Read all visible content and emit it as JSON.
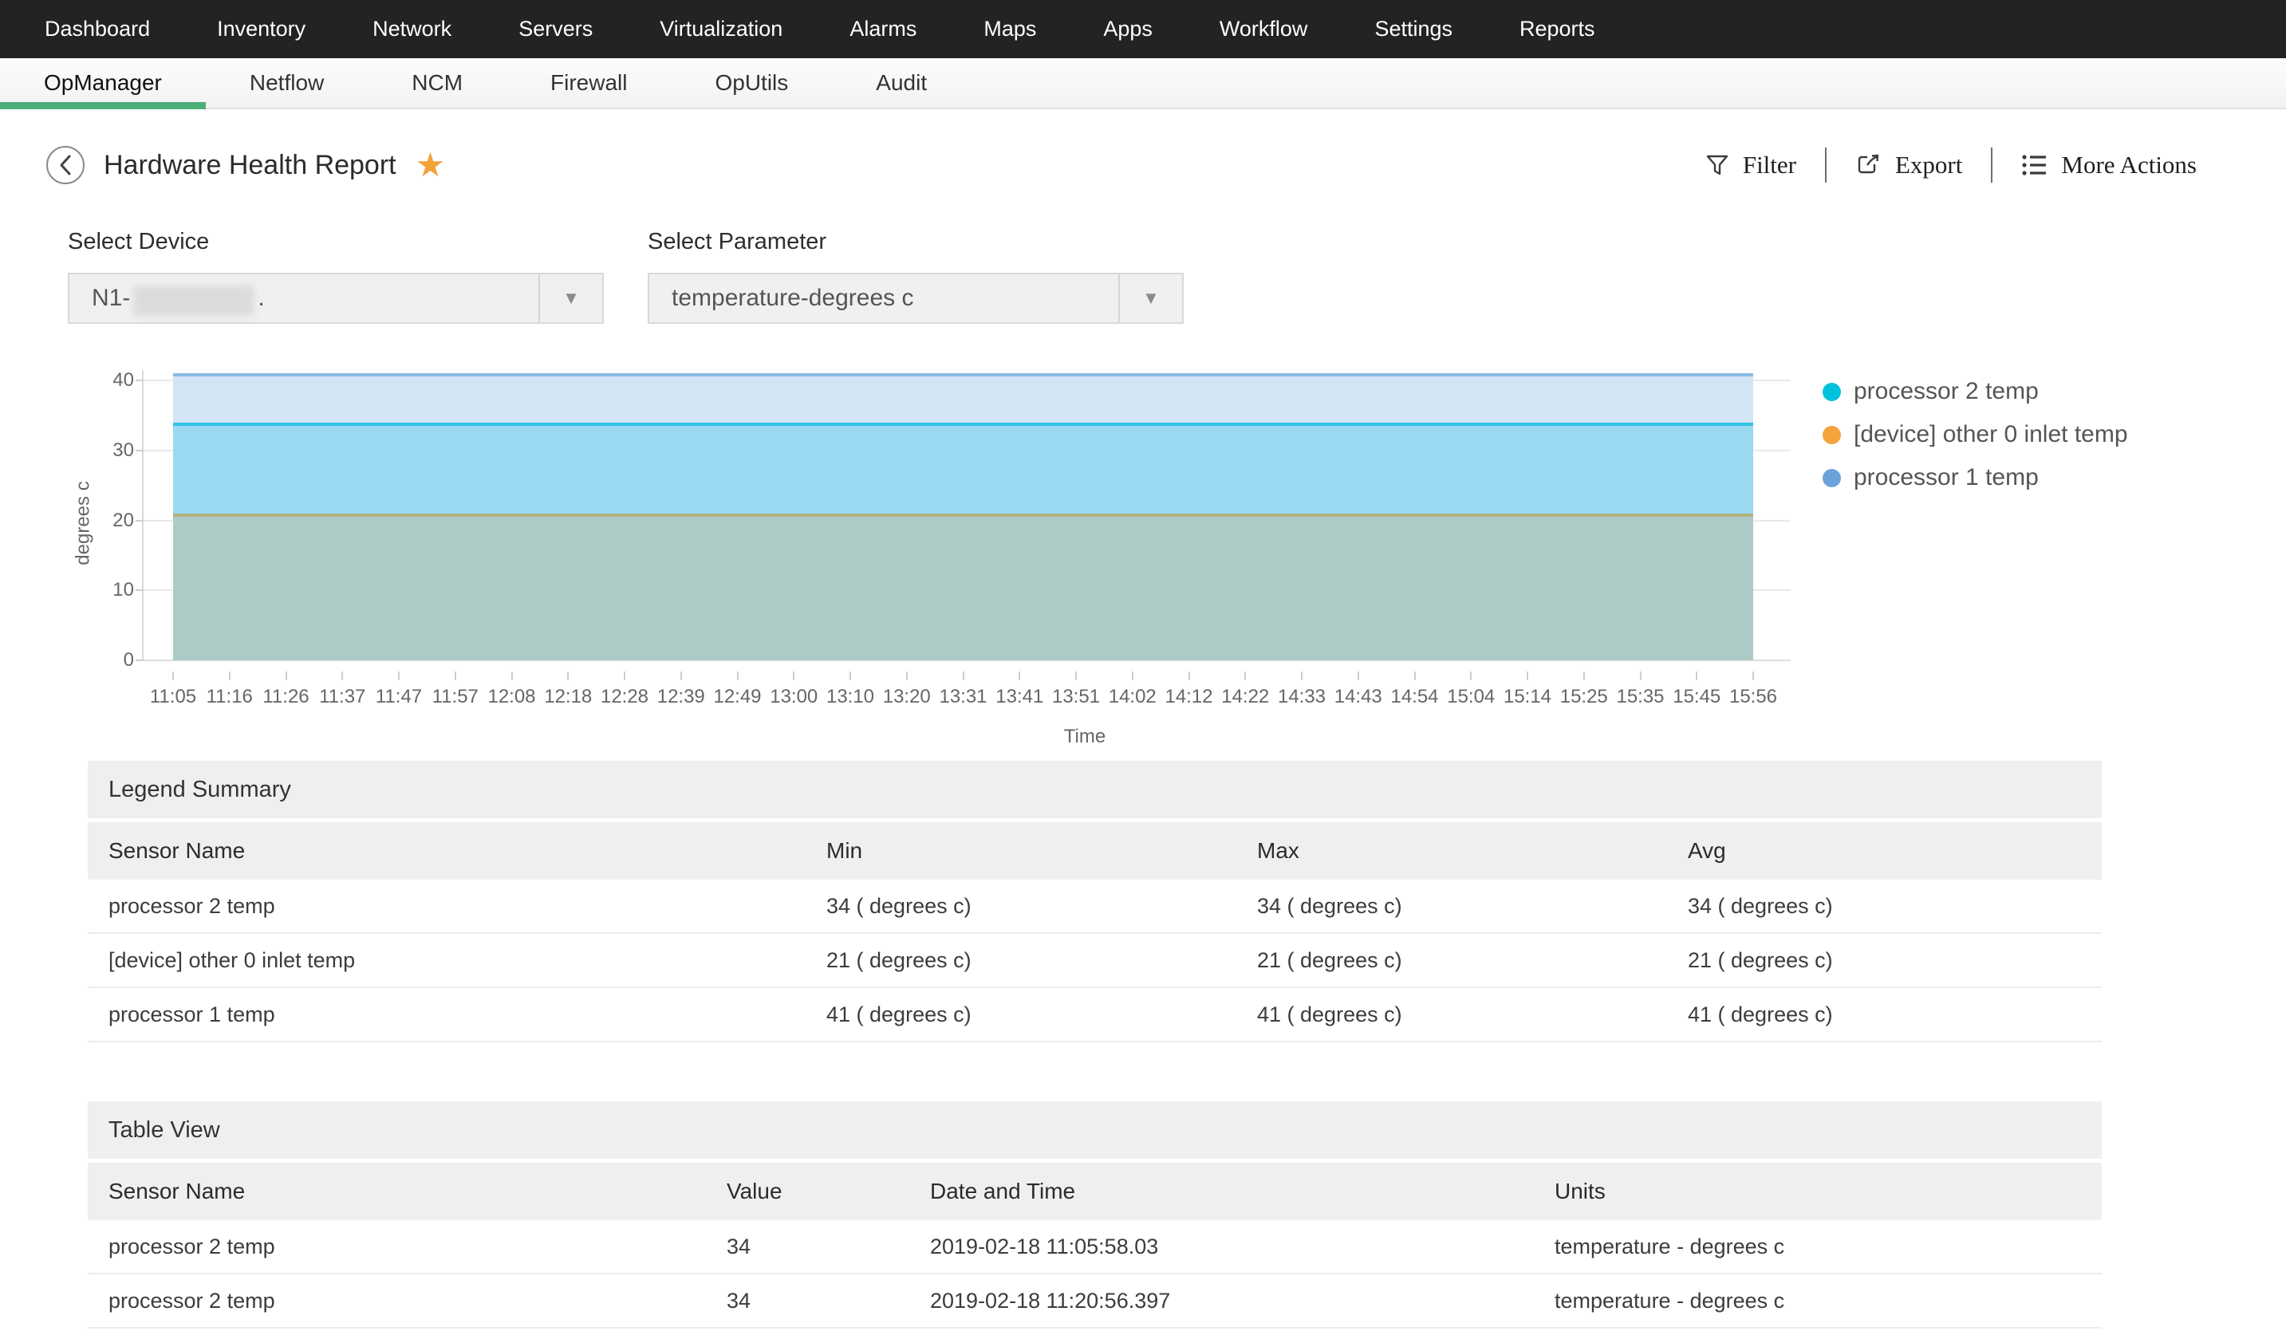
{
  "nav": {
    "items": [
      "Dashboard",
      "Inventory",
      "Network",
      "Servers",
      "Virtualization",
      "Alarms",
      "Maps",
      "Apps",
      "Workflow",
      "Settings",
      "Reports"
    ]
  },
  "tabs": {
    "items": [
      {
        "label": "OpManager",
        "active": true
      },
      {
        "label": "Netflow",
        "active": false
      },
      {
        "label": "NCM",
        "active": false
      },
      {
        "label": "Firewall",
        "active": false
      },
      {
        "label": "OpUtils",
        "active": false
      },
      {
        "label": "Audit",
        "active": false
      }
    ]
  },
  "header": {
    "title": "Hardware Health Report",
    "actions": [
      {
        "label": "Filter",
        "icon": "filter-icon"
      },
      {
        "label": "Export",
        "icon": "export-icon"
      },
      {
        "label": "More Actions",
        "icon": "list-icon"
      }
    ]
  },
  "filters": {
    "device": {
      "label": "Select Device",
      "value_prefix": "N1-",
      "value_suffix": ".",
      "value_masked": true
    },
    "parameter": {
      "label": "Select Parameter",
      "value": "temperature-degrees c"
    }
  },
  "chart_data": {
    "type": "area",
    "title": "",
    "xlabel": "Time",
    "ylabel": "degrees c",
    "ylim": [
      0,
      41.5
    ],
    "yticks": [
      0,
      10,
      20,
      30,
      40
    ],
    "grid": true,
    "legend_position": "right",
    "x": [
      "11:05",
      "11:16",
      "11:26",
      "11:37",
      "11:47",
      "11:57",
      "12:08",
      "12:18",
      "12:28",
      "12:39",
      "12:49",
      "13:00",
      "13:10",
      "13:20",
      "13:31",
      "13:41",
      "13:51",
      "14:02",
      "14:12",
      "14:22",
      "14:33",
      "14:43",
      "14:54",
      "15:04",
      "15:14",
      "15:25",
      "15:35",
      "15:45",
      "15:56"
    ],
    "series": [
      {
        "name": "processor 2 temp",
        "color": "#00c1de",
        "band_fill": "#9ad9f1",
        "line_color": "#2ec4e6",
        "value": 34,
        "values": [
          34,
          34,
          34,
          34,
          34,
          34,
          34,
          34,
          34,
          34,
          34,
          34,
          34,
          34,
          34,
          34,
          34,
          34,
          34,
          34,
          34,
          34,
          34,
          34,
          34,
          34,
          34,
          34,
          34
        ]
      },
      {
        "name": "[device] other 0 inlet temp",
        "color": "#f6a33c",
        "band_fill": "#aecac6",
        "line_color": "#b1b07b",
        "value": 21,
        "values": [
          21,
          21,
          21,
          21,
          21,
          21,
          21,
          21,
          21,
          21,
          21,
          21,
          21,
          21,
          21,
          21,
          21,
          21,
          21,
          21,
          21,
          21,
          21,
          21,
          21,
          21,
          21,
          21,
          21
        ]
      },
      {
        "name": "processor 1 temp",
        "color": "#6ba3d9",
        "band_fill": "#d3e4f5",
        "line_color": "#8abae2",
        "value": 41,
        "values": [
          41,
          41,
          41,
          41,
          41,
          41,
          41,
          41,
          41,
          41,
          41,
          41,
          41,
          41,
          41,
          41,
          41,
          41,
          41,
          41,
          41,
          41,
          41,
          41,
          41,
          41,
          41,
          41,
          41
        ]
      }
    ]
  },
  "legend_summary": {
    "title": "Legend Summary",
    "columns": [
      "Sensor Name",
      "Min",
      "Max",
      "Avg"
    ],
    "rows": [
      [
        "processor 2 temp",
        "34 ( degrees c)",
        "34 ( degrees c)",
        "34 ( degrees c)"
      ],
      [
        "[device] other 0 inlet temp",
        "21 ( degrees c)",
        "21 ( degrees c)",
        "21 ( degrees c)"
      ],
      [
        "processor 1 temp",
        "41 ( degrees c)",
        "41 ( degrees c)",
        "41 ( degrees c)"
      ]
    ]
  },
  "table_view": {
    "title": "Table View",
    "columns": [
      "Sensor Name",
      "Value",
      "Date and Time",
      "Units"
    ],
    "rows": [
      [
        "processor 2 temp",
        "34",
        "2019-02-18 11:05:58.03",
        "temperature - degrees c"
      ],
      [
        "processor 2 temp",
        "34",
        "2019-02-18 11:20:56.397",
        "temperature - degrees c"
      ]
    ]
  },
  "colors": {
    "nav_bg": "#232323",
    "active_tab_underline": "#4baf78",
    "star": "#f2a33a",
    "section_header_bg": "#efefef"
  }
}
